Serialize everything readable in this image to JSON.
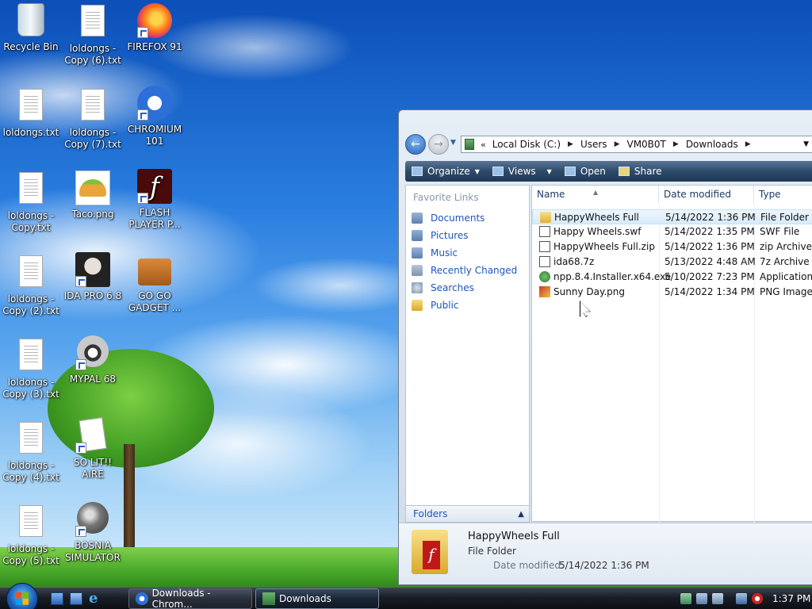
{
  "desktop": {
    "icons": [
      {
        "label": "Recycle Bin",
        "icon": "recycle-bin-icon"
      },
      {
        "label": "loldongs - Copy (6).txt",
        "icon": "text-file-icon"
      },
      {
        "label": "FIREFOX 91",
        "icon": "firefox-icon"
      },
      {
        "label": "loldongs.txt",
        "icon": "text-file-icon"
      },
      {
        "label": "loldongs - Copy (7).txt",
        "icon": "text-file-icon"
      },
      {
        "label": "CHROMIUM 101",
        "icon": "chromium-icon"
      },
      {
        "label": "loldongs - Copy.txt",
        "icon": "text-file-icon"
      },
      {
        "label": "Taco.png",
        "icon": "taco-image-icon"
      },
      {
        "label": "FLASH PLAYER P...",
        "icon": "flash-player-icon"
      },
      {
        "label": "loldongs - Copy (2).txt",
        "icon": "text-file-icon"
      },
      {
        "label": "IDA PRO 6.8",
        "icon": "ida-pro-icon"
      },
      {
        "label": "GO GO GADGET ...",
        "icon": "briefcase-icon"
      },
      {
        "label": "loldongs - Copy (3).txt",
        "icon": "text-file-icon"
      },
      {
        "label": "MYPAL 68",
        "icon": "mypal-raccoon-icon"
      },
      {
        "label": "loldongs - Copy (4).txt",
        "icon": "text-file-icon"
      },
      {
        "label": "SO LIT!! AIRE",
        "icon": "solitaire-cards-icon"
      },
      {
        "label": "loldongs - Copy (5).txt",
        "icon": "text-file-icon"
      },
      {
        "label": "BOSNIA SIMULATOR",
        "icon": "mine-icon"
      }
    ]
  },
  "explorer": {
    "address": {
      "overflow": "«",
      "crumbs": [
        "Local Disk (C:)",
        "Users",
        "VM0B0T",
        "Downloads"
      ]
    },
    "commands": {
      "organize": "Organize",
      "views": "Views",
      "open": "Open",
      "share": "Share"
    },
    "nav": {
      "title": "Favorite Links",
      "links": [
        "Documents",
        "Pictures",
        "Music",
        "Recently Changed",
        "Searches",
        "Public"
      ],
      "folders_label": "Folders"
    },
    "columns": {
      "name": "Name",
      "date": "Date modified",
      "type": "Type"
    },
    "files": [
      {
        "name": "HappyWheels Full",
        "date": "5/14/2022 1:36 PM",
        "type": "File Folder",
        "icon": "folder-icon"
      },
      {
        "name": "Happy Wheels.swf",
        "date": "5/14/2022 1:35 PM",
        "type": "SWF File",
        "icon": "swf-file-icon"
      },
      {
        "name": "HappyWheels Full.zip",
        "date": "5/14/2022 1:36 PM",
        "type": "zip Archive",
        "icon": "zip-file-icon"
      },
      {
        "name": "ida68.7z",
        "date": "5/13/2022 4:48 AM",
        "type": "7z Archive",
        "icon": "7z-file-icon"
      },
      {
        "name": "npp.8.4.Installer.x64.exe",
        "date": "5/10/2022 7:23 PM",
        "type": "Application",
        "icon": "exe-file-icon"
      },
      {
        "name": "Sunny Day.png",
        "date": "5/14/2022 1:34 PM",
        "type": "PNG Image",
        "icon": "png-file-icon"
      }
    ],
    "details": {
      "name": "HappyWheels Full",
      "type": "File Folder",
      "modified_label": "Date modified:",
      "modified_value": "5/14/2022 1:36 PM"
    }
  },
  "taskbar": {
    "tasks": [
      {
        "label": "Downloads - Chrom...",
        "icon": "chromium-icon"
      },
      {
        "label": "Downloads",
        "icon": "explorer-icon"
      }
    ],
    "clock": "1:37 PM"
  }
}
